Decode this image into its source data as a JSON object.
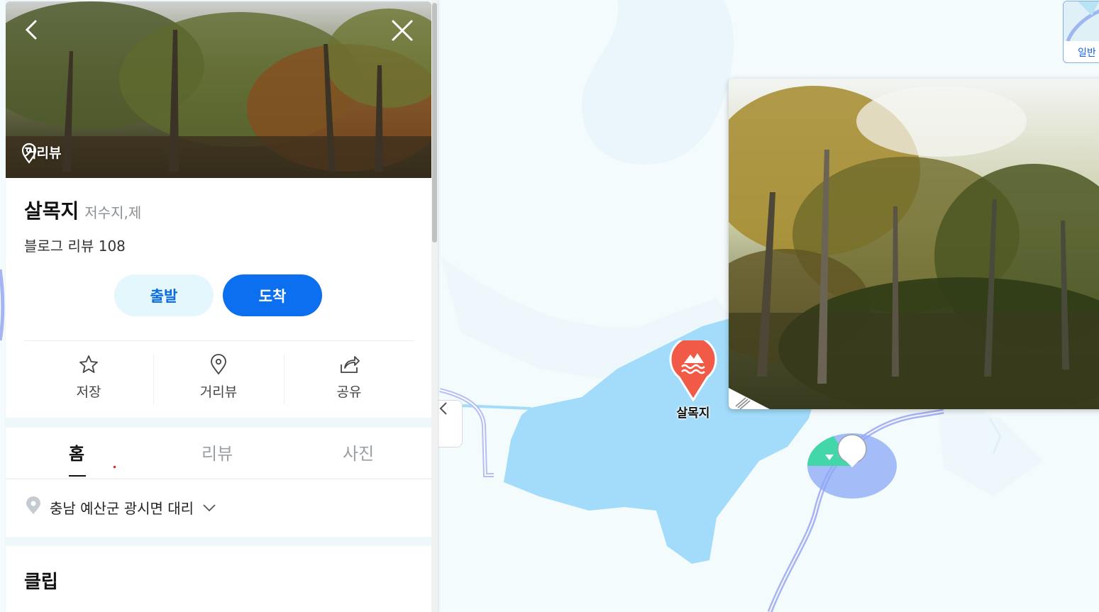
{
  "map": {
    "map_type_label": "일반",
    "marker_label": "살목지",
    "colors": {
      "water": "#a2dcfa",
      "land": "#f4fbfd",
      "road": "#a6b4f2",
      "marker": "#f05a46",
      "accent": "#0b6ff0"
    }
  },
  "panel": {
    "hero": {
      "street_view_label": "거리뷰"
    },
    "place": {
      "name": "살목지",
      "category": "저수지,제",
      "blog_review": "블로그 리뷰 108"
    },
    "route": {
      "depart_label": "출발",
      "arrive_label": "도착"
    },
    "actions": [
      {
        "label": "저장",
        "icon": "star-icon"
      },
      {
        "label": "거리뷰",
        "icon": "location-pin-icon"
      },
      {
        "label": "공유",
        "icon": "share-icon"
      }
    ],
    "tabs": [
      {
        "label": "홈",
        "active": true
      },
      {
        "label": "리뷰",
        "active": false
      },
      {
        "label": "사진",
        "active": false
      }
    ],
    "address": "충남 예산군 광시면 대리",
    "clip_title": "클립"
  }
}
